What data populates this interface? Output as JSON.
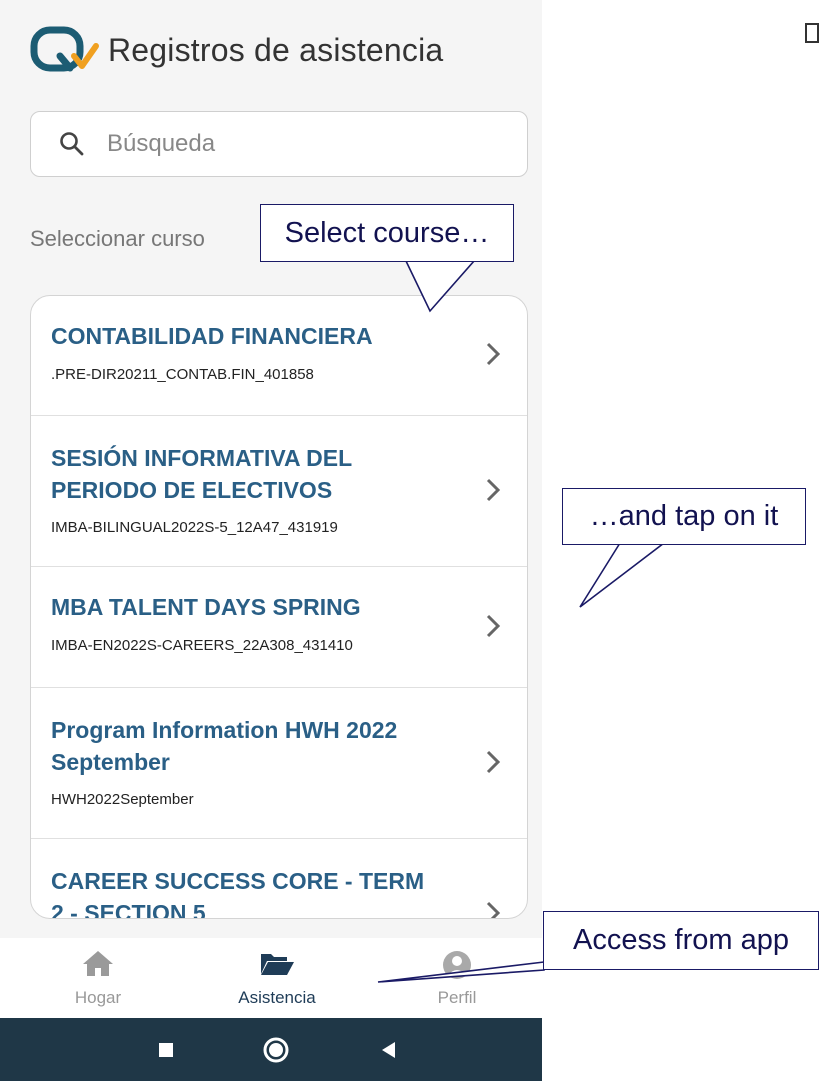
{
  "header": {
    "title": "Registros de asistencia",
    "logo_icon": "qv-logo-icon"
  },
  "search": {
    "placeholder": "Búsqueda",
    "icon": "search-icon"
  },
  "select_label": "Seleccionar curso",
  "courses": [
    {
      "title": "CONTABILIDAD FINANCIERA",
      "code": ".PRE-DIR20211_CONTAB.FIN_401858"
    },
    {
      "title": "SESIÓN INFORMATIVA DEL PERIODO DE ELECTIVOS",
      "code": "IMBA-BILINGUAL2022S-5_12A47_431919"
    },
    {
      "title": "MBA TALENT DAYS SPRING",
      "code": "IMBA-EN2022S-CAREERS_22A308_431410"
    },
    {
      "title": "Program Information HWH 2022 September",
      "code": "HWH2022September"
    },
    {
      "title": "CAREER SUCCESS CORE - TERM 2 - SECTION 5",
      "code": ""
    }
  ],
  "nav": {
    "items": [
      {
        "label": "Hogar",
        "icon": "home-icon",
        "active": false
      },
      {
        "label": "Asistencia",
        "icon": "folder-open-icon",
        "active": true
      },
      {
        "label": "Perfil",
        "icon": "profile-icon",
        "active": false
      }
    ]
  },
  "system_nav": {
    "icons": [
      "recents-square-icon",
      "home-circle-icon",
      "back-triangle-icon"
    ]
  },
  "annotations": {
    "select_course": "Select course…",
    "tap_on_it": "…and tap on it",
    "access_from_app": "Access from app"
  },
  "colors": {
    "accent_blue": "#2a5f86",
    "logo_teal": "#1c5c73",
    "logo_orange": "#f0a020",
    "nav_active": "#1f3c57",
    "system_bar": "#1f3747",
    "callout_border": "#1a1a66"
  }
}
